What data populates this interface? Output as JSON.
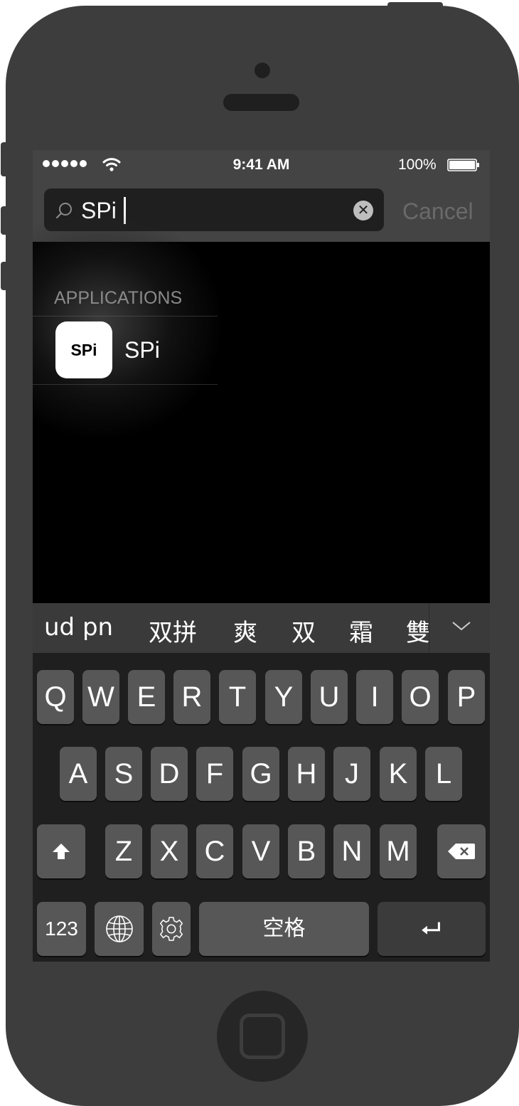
{
  "status_bar": {
    "time": "9:41 AM",
    "battery_percent": "100%",
    "battery_level": 1.0,
    "signal_dots": 5
  },
  "search": {
    "query": "SPi",
    "cancel_label": "Cancel"
  },
  "results": {
    "section_label": "APPLICATIONS",
    "items": [
      {
        "icon_text": "SPi",
        "name": "SPi"
      }
    ]
  },
  "candidates": [
    "ud pn",
    "双拼",
    "爽",
    "双",
    "霜",
    "雙"
  ],
  "keyboard": {
    "row1": [
      "Q",
      "W",
      "E",
      "R",
      "T",
      "Y",
      "U",
      "I",
      "O",
      "P"
    ],
    "row2": [
      "A",
      "S",
      "D",
      "F",
      "G",
      "H",
      "J",
      "K",
      "L"
    ],
    "row3": [
      "Z",
      "X",
      "C",
      "V",
      "B",
      "N",
      "M"
    ],
    "numbers_label": "123",
    "space_label": "空格"
  },
  "icons": {
    "search": "search-icon",
    "clear": "clear-icon",
    "wifi": "wifi-icon",
    "battery": "battery-icon",
    "expand": "chevron-down-icon",
    "shift": "shift-icon",
    "delete": "backspace-icon",
    "globe": "globe-icon",
    "settings": "gear-icon",
    "return": "return-icon"
  }
}
